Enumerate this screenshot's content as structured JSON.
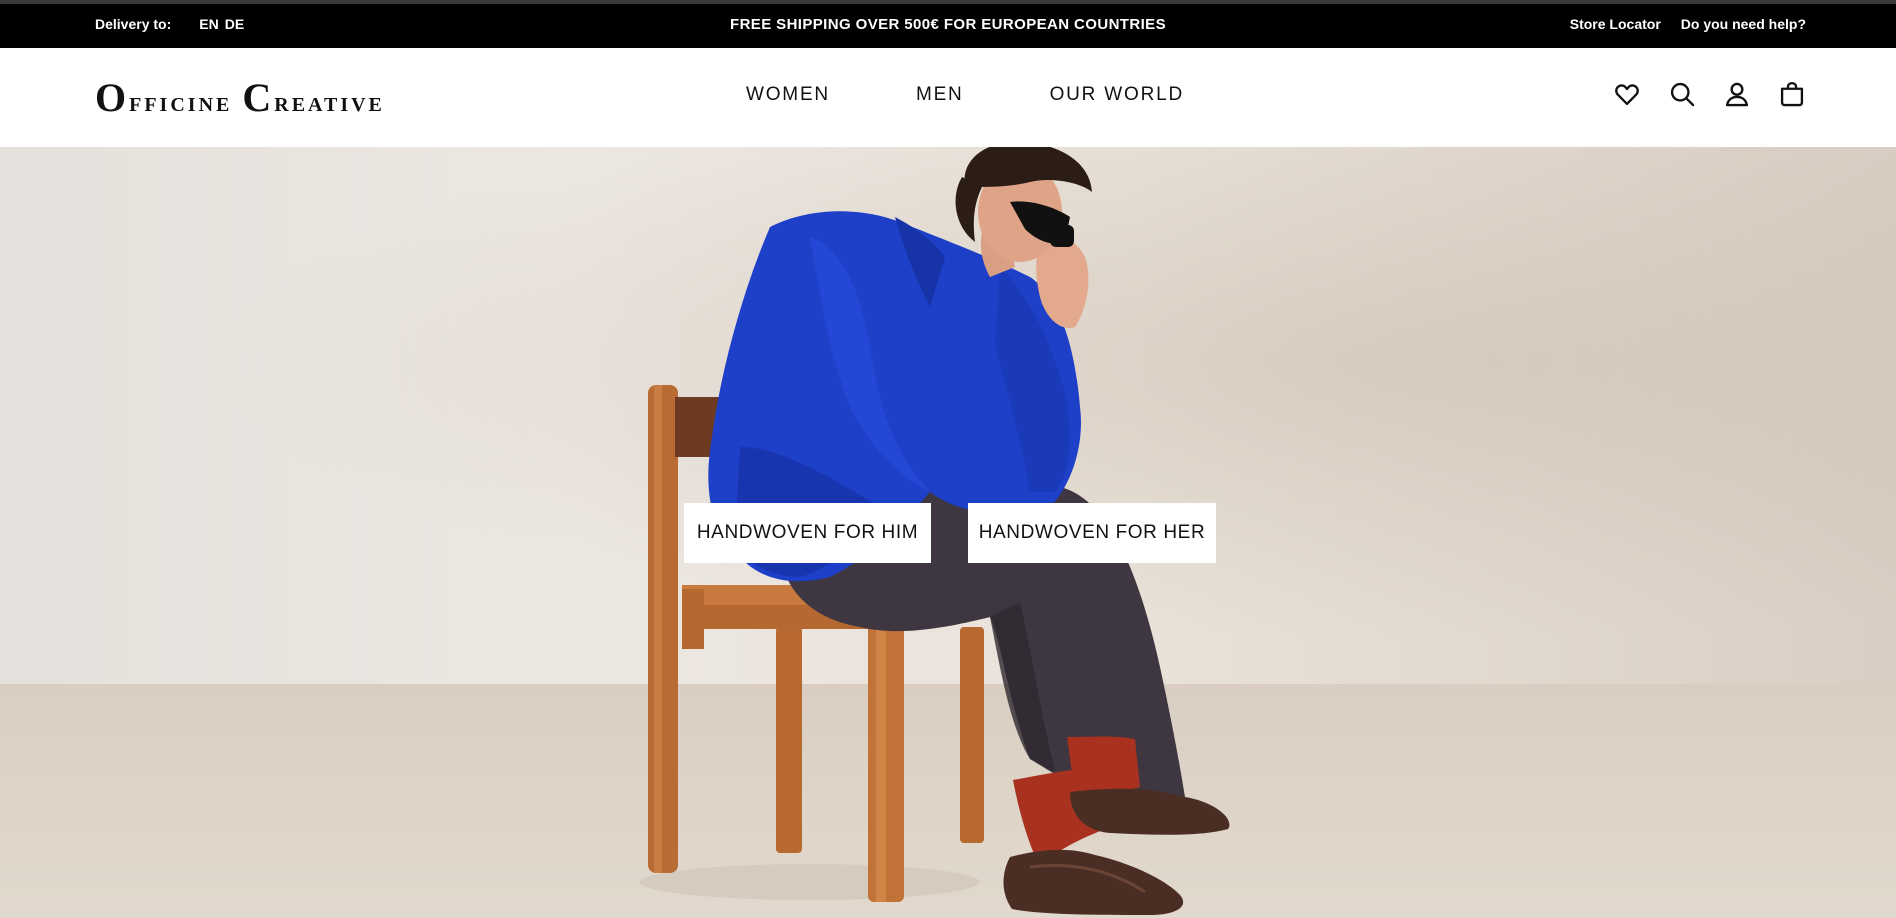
{
  "topbar": {
    "delivery_label": "Delivery to:",
    "lang_en": "EN",
    "lang_de": "DE",
    "announcement": "FREE SHIPPING OVER 500€ FOR EUROPEAN COUNTRIES",
    "store_locator": "Store Locator",
    "help": "Do you need help?"
  },
  "header": {
    "logo_word1_initial": "O",
    "logo_word1_rest": "fficine",
    "logo_word2_initial": "C",
    "logo_word2_rest": "reative",
    "nav": [
      "WOMEN",
      "MEN",
      "OUR WORLD"
    ],
    "icons": [
      "heart-icon",
      "search-icon",
      "user-icon",
      "shopping-bag-icon"
    ]
  },
  "hero": {
    "cta_him": "HANDWOVEN FOR HIM",
    "cta_her": "HANDWOVEN FOR HER"
  },
  "colors": {
    "topbar_bg": "#000000",
    "jacket": "#1e3fc8",
    "trousers": "#3e3640",
    "chair": "#c4773a",
    "socks": "#a8311f",
    "shoes": "#4a2e24"
  }
}
